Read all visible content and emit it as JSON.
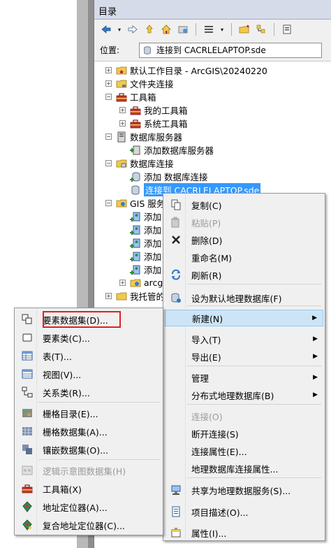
{
  "catalog": {
    "title": "目录",
    "location_label": "位置:",
    "location_value": "连接到 CACRLELAPTOP.sde"
  },
  "tree": [
    {
      "label": "默认工作目录 - ArcGIS\\20240220",
      "icon": "folder-home-icon",
      "expander": "+"
    },
    {
      "label": "文件夹连接",
      "icon": "folder-connection-icon",
      "expander": "+"
    },
    {
      "label": "工具箱",
      "icon": "toolbox-icon",
      "expander": "-"
    },
    {
      "label": "我的工具箱",
      "icon": "toolbox-icon",
      "expander": "+"
    },
    {
      "label": "系统工具箱",
      "icon": "toolbox-icon",
      "expander": "+"
    },
    {
      "label": "数据库服务器",
      "icon": "database-server-icon",
      "expander": "-"
    },
    {
      "label": "添加数据库服务器",
      "icon": "add-server-icon",
      "expander": ""
    },
    {
      "label": "数据库连接",
      "icon": "database-connection-icon",
      "expander": "-"
    },
    {
      "label": "添加 数据库连接",
      "icon": "add-connection-icon",
      "expander": ""
    },
    {
      "label": "连接到 CACRLELAPTOP.sde",
      "icon": "database-icon",
      "expander": ""
    },
    {
      "label": "GIS 服务",
      "icon": "gis-server-icon",
      "expander": "-"
    },
    {
      "label": "添加",
      "icon": "add-gis-server-icon",
      "expander": ""
    },
    {
      "label": "添加",
      "icon": "add-gis-server-icon",
      "expander": ""
    },
    {
      "label": "添加",
      "icon": "add-gis-server-icon",
      "expander": ""
    },
    {
      "label": "添加",
      "icon": "add-gis-server-icon",
      "expander": ""
    },
    {
      "label": "添加",
      "icon": "add-gis-server-icon",
      "expander": ""
    },
    {
      "label": "arcg",
      "icon": "gis-server-icon",
      "expander": "+"
    },
    {
      "label": "我托管的",
      "icon": "hosted-icon",
      "expander": "+"
    }
  ],
  "context_menu": [
    {
      "label": "复制(C)",
      "icon": "copy-icon",
      "disabled": false
    },
    {
      "label": "粘贴(P)",
      "icon": "paste-icon",
      "disabled": true
    },
    {
      "label": "删除(D)",
      "icon": "delete-icon",
      "disabled": false
    },
    {
      "label": "重命名(M)",
      "icon": "",
      "disabled": false
    },
    {
      "label": "刷新(R)",
      "icon": "refresh-icon",
      "disabled": false
    },
    {
      "label": "设为默认地理数据库(F)",
      "icon": "default-gdb-icon",
      "disabled": false
    },
    {
      "label": "新建(N)",
      "icon": "",
      "disabled": false,
      "submenu": true,
      "highlighted": true
    },
    {
      "label": "导入(T)",
      "icon": "",
      "disabled": false,
      "submenu": true
    },
    {
      "label": "导出(E)",
      "icon": "",
      "disabled": false,
      "submenu": true
    },
    {
      "label": "管理",
      "icon": "",
      "disabled": false,
      "submenu": true
    },
    {
      "label": "分布式地理数据库(B)",
      "icon": "",
      "disabled": false,
      "submenu": true
    },
    {
      "label": "连接(O)",
      "icon": "",
      "disabled": true
    },
    {
      "label": "断开连接(S)",
      "icon": "",
      "disabled": false
    },
    {
      "label": "连接属性(E)...",
      "icon": "",
      "disabled": false
    },
    {
      "label": "地理数据库连接属性...",
      "icon": "",
      "disabled": false
    },
    {
      "label": "共享为地理数据服务(S)...",
      "icon": "share-service-icon",
      "disabled": false
    },
    {
      "label": "项目描述(O)...",
      "icon": "item-description-icon",
      "disabled": false
    },
    {
      "label": "属性(I)...",
      "icon": "properties-icon",
      "disabled": false
    }
  ],
  "new_submenu": [
    {
      "label": "要素数据集(D)...",
      "icon": "feature-dataset-icon",
      "disabled": false,
      "boxed": true
    },
    {
      "label": "要素类(C)...",
      "icon": "feature-class-icon",
      "disabled": false
    },
    {
      "label": "表(T)...",
      "icon": "table-icon",
      "disabled": false
    },
    {
      "label": "视图(V)...",
      "icon": "view-icon",
      "disabled": false
    },
    {
      "label": "关系类(R)...",
      "icon": "relationship-class-icon",
      "disabled": false
    },
    {
      "label": "栅格目录(E)...",
      "icon": "raster-catalog-icon",
      "disabled": false
    },
    {
      "label": "栅格数据集(A)...",
      "icon": "raster-dataset-icon",
      "disabled": false
    },
    {
      "label": "镶嵌数据集(O)...",
      "icon": "mosaic-dataset-icon",
      "disabled": false
    },
    {
      "label": "逻辑示意图数据集(H)",
      "icon": "schematic-dataset-icon",
      "disabled": true
    },
    {
      "label": "工具箱(X)",
      "icon": "toolbox-icon",
      "disabled": false
    },
    {
      "label": "地址定位器(A)...",
      "icon": "address-locator-icon",
      "disabled": false
    },
    {
      "label": "复合地址定位器(C)...",
      "icon": "composite-locator-icon",
      "disabled": false
    }
  ],
  "colors": {
    "selection": "#3399ff",
    "highlight": "#cce4f7",
    "callout": "#e02020"
  }
}
